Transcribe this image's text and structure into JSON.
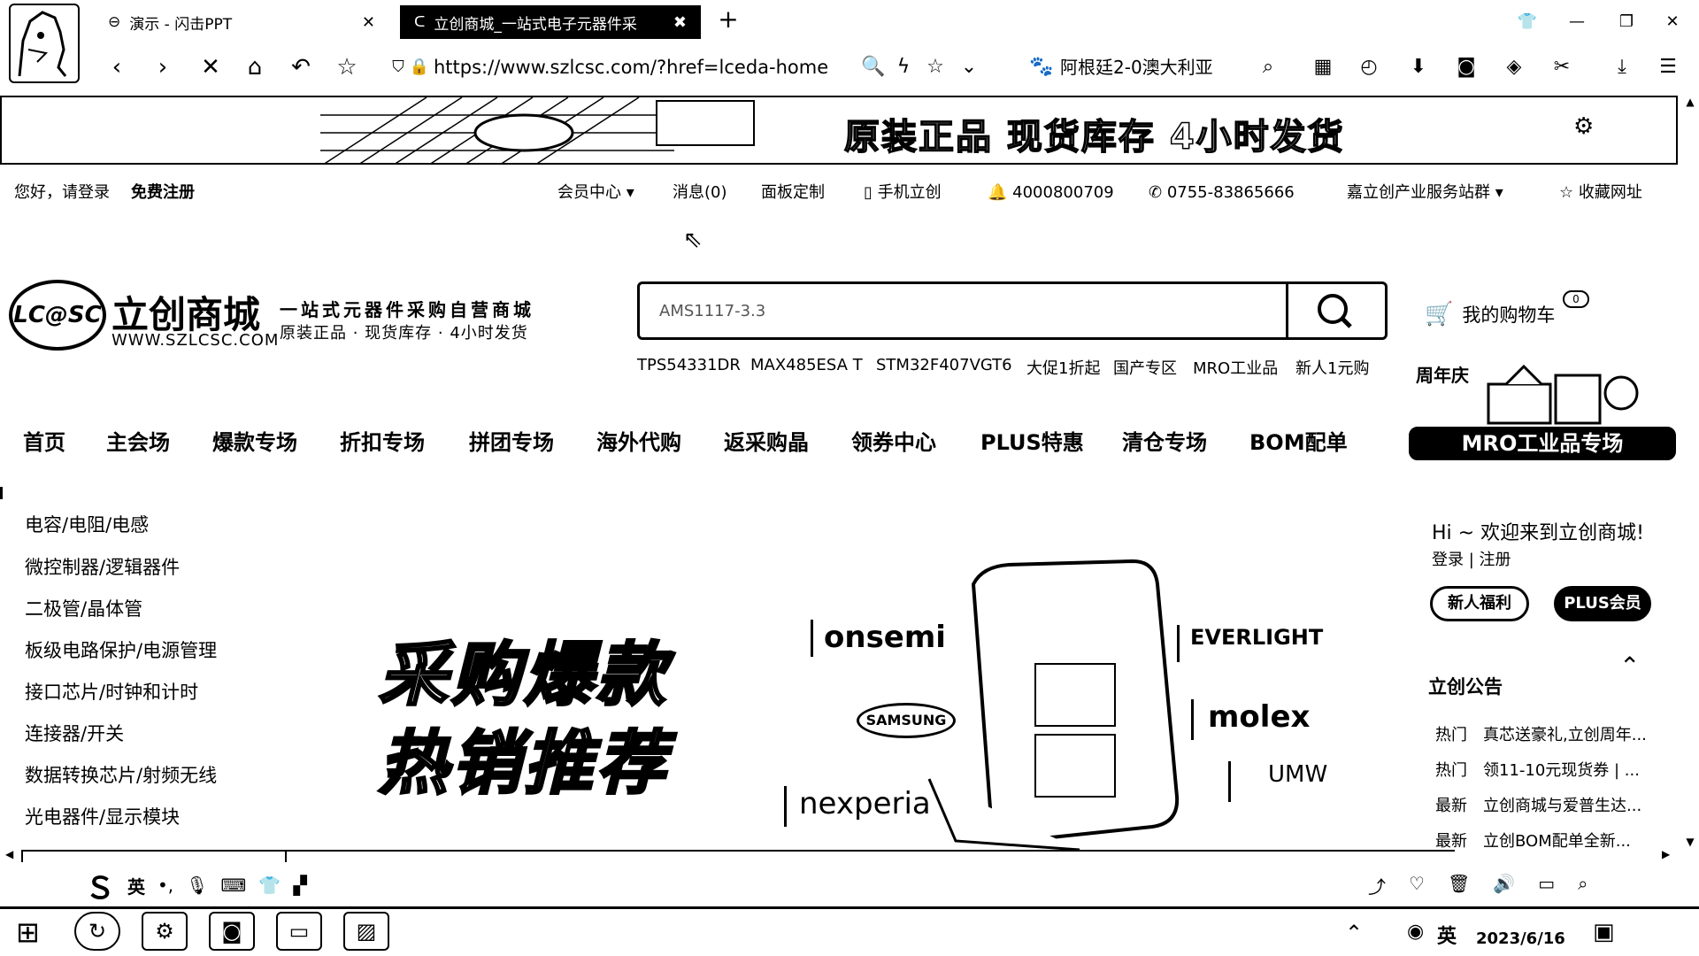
{
  "browser": {
    "tabs": [
      {
        "label": "演示 - 闪击PPT",
        "active": false
      },
      {
        "label": "立创商城_一站式电子元器件采",
        "active": true
      }
    ],
    "url": "https://www.szlcsc.com/?href=lceda-home",
    "quick_link": "阿根廷2-0澳大利亚"
  },
  "banner": {
    "text": "原装正品 现货库存 4小时发货"
  },
  "topbar": {
    "greeting": "您好，请登录",
    "register": "免费注册",
    "links": [
      "会员中心",
      "消息(0)",
      "面板定制",
      "手机立创",
      "4000800709",
      "0755-83865666",
      "嘉立创产业服务站群",
      "收藏网址"
    ]
  },
  "logo": {
    "mark": "LC@SC",
    "brand": "立创商城",
    "url": "WWW.SZLCSC.COM",
    "slogan1": "一站式元器件采购自营商城",
    "slogan2": "原装正品 · 现货库存 · 4小时发货"
  },
  "search": {
    "value": "AMS1117-3.3",
    "hot_words": [
      "TPS54331DR",
      "MAX485ESA T",
      "STM32F407VGT6",
      "大促1折起",
      "国产专区",
      "MRO工业品",
      "新人1元购"
    ]
  },
  "cart": {
    "label": "我的购物车",
    "count": "0"
  },
  "main_nav": [
    "首页",
    "主会场",
    "爆款专场",
    "折扣专场",
    "拼团专场",
    "海外代购",
    "返采购晶",
    "领券中心",
    "PLUS特惠",
    "清仓专场",
    "BOM配单"
  ],
  "mro": {
    "tag": "周年庆",
    "label": "MRO工业品专场"
  },
  "categories": [
    "电容/电阻/电感",
    "微控制器/逻辑器件",
    "二极管/晶体管",
    "板级电路保护/电源管理",
    "接口芯片/时钟和计时",
    "连接器/开关",
    "数据转换芯片/射频无线",
    "光电器件/显示模块"
  ],
  "hero": {
    "line1": "采购爆款",
    "line2": "热销推荐",
    "brands": [
      "onsemi",
      "EVERLIGHT",
      "SAMSUNG",
      "molex",
      "UMW",
      "nexperia"
    ]
  },
  "right_panel": {
    "welcome": "Hi ~ 欢迎来到立创商城!",
    "login": "登录",
    "register": "注册",
    "buttons": [
      "新人福利",
      "PLUS会员"
    ],
    "announce_title": "立创公告",
    "announcements": [
      {
        "tag": "热门",
        "text": "真芯送豪礼,立创周年..."
      },
      {
        "tag": "热门",
        "text": "领11-10元现货券 | ..."
      },
      {
        "tag": "最新",
        "text": "立创商城与爱普生达..."
      },
      {
        "tag": "最新",
        "text": "立创BOM配单全新..."
      }
    ]
  },
  "ime": {
    "lang": "英"
  },
  "taskbar": {
    "date": "2023/6/16",
    "lang": "英"
  }
}
